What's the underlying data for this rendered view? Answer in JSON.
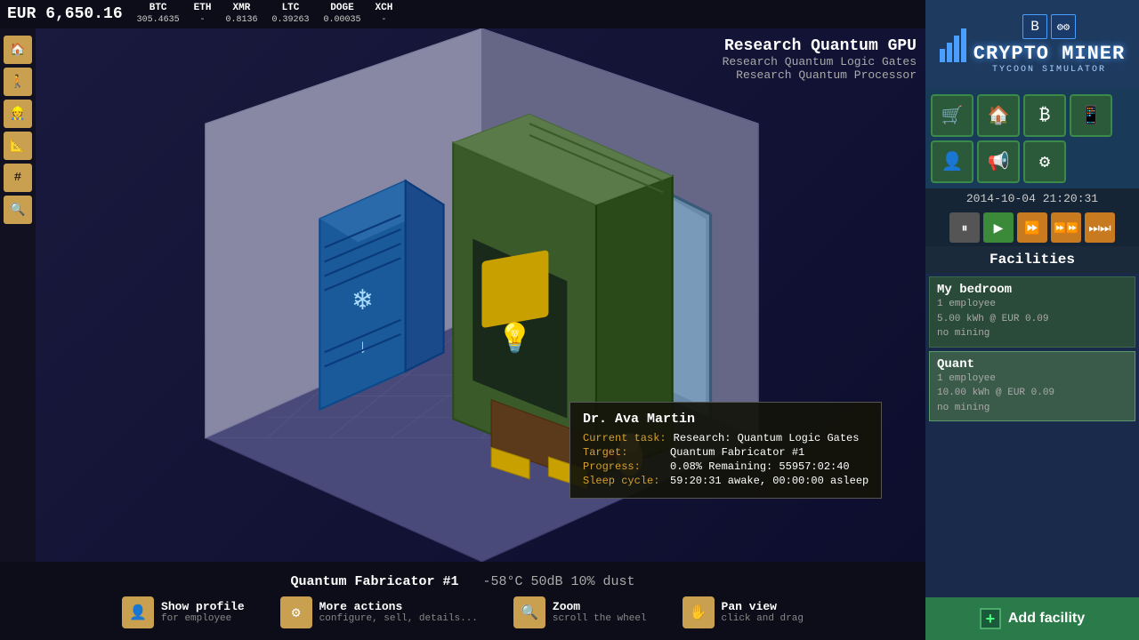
{
  "topbar": {
    "currency": "EUR 6,650.16",
    "cryptos": [
      {
        "name": "BTC",
        "value": "305.4635"
      },
      {
        "name": "ETH",
        "value": "-"
      },
      {
        "name": "XMR",
        "value": "0.8136"
      },
      {
        "name": "LTC",
        "value": "0.39263"
      },
      {
        "name": "DOGE",
        "value": "0.00035"
      },
      {
        "name": "XCH",
        "value": ""
      }
    ]
  },
  "research_panel": {
    "title": "Research Quantum GPU",
    "sub1": "Research Quantum Logic Gates",
    "sub2": "Research Quantum Processor"
  },
  "facility_bar": {
    "name": "Quantum Fabricator #1",
    "stats": "-58°C  50dB  10% dust"
  },
  "action_buttons": [
    {
      "title": "Show profile",
      "sub": "for employee",
      "icon": "👤"
    },
    {
      "title": "More actions",
      "sub": "configure, sell, details...",
      "icon": "⚙"
    },
    {
      "title": "Zoom",
      "sub": "scroll the wheel",
      "icon": "🔍"
    },
    {
      "title": "Pan view",
      "sub": "click and drag",
      "icon": "✋"
    }
  ],
  "datetime": "2014-10-04 21:20:31",
  "speed_buttons": [
    {
      "label": "⏸",
      "type": "gray"
    },
    {
      "label": "▶",
      "type": "green"
    },
    {
      "label": "⏩",
      "type": "orange"
    },
    {
      "label": "⏩⏩",
      "type": "orange"
    },
    {
      "label": "⏭",
      "type": "orange"
    }
  ],
  "facilities_header": "Facilities",
  "facilities": [
    {
      "name": "My bedroom",
      "details": [
        "1 employee",
        "5.00 kWh @ EUR 0.09",
        "no mining"
      ]
    },
    {
      "name": "Quant",
      "details": [
        "1 employee",
        "10.00 kWh @ EUR 0.09",
        "no mining"
      ]
    }
  ],
  "add_facility_label": "Add facility",
  "employee_tooltip": {
    "name": "Dr. Ava Martin",
    "rows": [
      {
        "label": "Current task:",
        "value": "Research: Quantum Logic Gates"
      },
      {
        "label": "Target:",
        "value": "Quantum Fabricator #1"
      },
      {
        "label": "Progress:",
        "value": "0.08%  Remaining: 55957:02:40"
      },
      {
        "label": "Sleep cycle:",
        "value": "59:20:31 awake, 00:00:00 asleep"
      }
    ]
  },
  "left_tools": [
    "🏠",
    "🚶",
    "👷",
    "📐",
    "#",
    "🔍"
  ],
  "logo": {
    "main": "CRYPTO MINER",
    "sub": "TYCOON SIMULATOR"
  },
  "nav_icons": [
    {
      "icon": "🛒",
      "color": "green"
    },
    {
      "icon": "🏠",
      "color": "green"
    },
    {
      "icon": "₿",
      "color": "green"
    },
    {
      "icon": "📱",
      "color": "green"
    },
    {
      "icon": "👤",
      "color": "green"
    },
    {
      "icon": "📢",
      "color": "green"
    },
    {
      "icon": "⚙",
      "color": "green"
    }
  ]
}
